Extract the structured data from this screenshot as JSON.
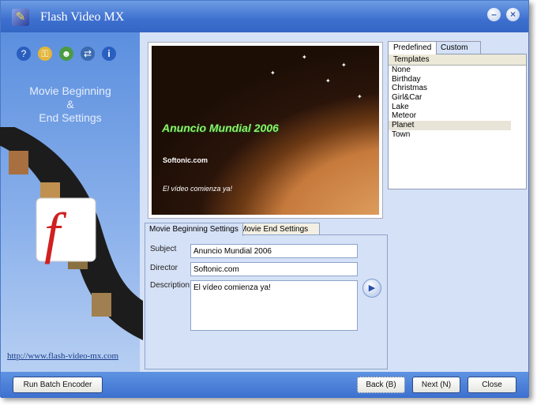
{
  "window": {
    "title": "Flash Video MX",
    "minimize": "–",
    "close": "×"
  },
  "sidebar": {
    "heading_line1": "Movie Beginning",
    "heading_line2": "&",
    "heading_line3": "End Settings",
    "url": "http://www.flash-video-mx.com"
  },
  "preview": {
    "headline": "Anuncio Mundial 2006",
    "subtitle": "Softonic.com",
    "description": "El vídeo comienza ya!"
  },
  "templates": {
    "tabs": [
      "Predefined",
      "Custom"
    ],
    "header": "Templates",
    "items": [
      "None",
      "Birthday",
      "Christmas",
      "Girl&Car",
      "Lake",
      "Meteor",
      "Planet",
      "Town"
    ],
    "selected": "Planet"
  },
  "settings": {
    "tabs": [
      "Movie Beginning Settings",
      "Movie End Settings"
    ],
    "subject_label": "Subject",
    "subject_value": "Anuncio Mundial 2006",
    "director_label": "Director",
    "director_value": "Softonic.com",
    "description_label": "Description:",
    "description_value": "El vídeo comienza ya!"
  },
  "buttons": {
    "batch": "Run Batch Encoder",
    "back": "Back (B)",
    "next": "Next (N)",
    "close": "Close"
  }
}
